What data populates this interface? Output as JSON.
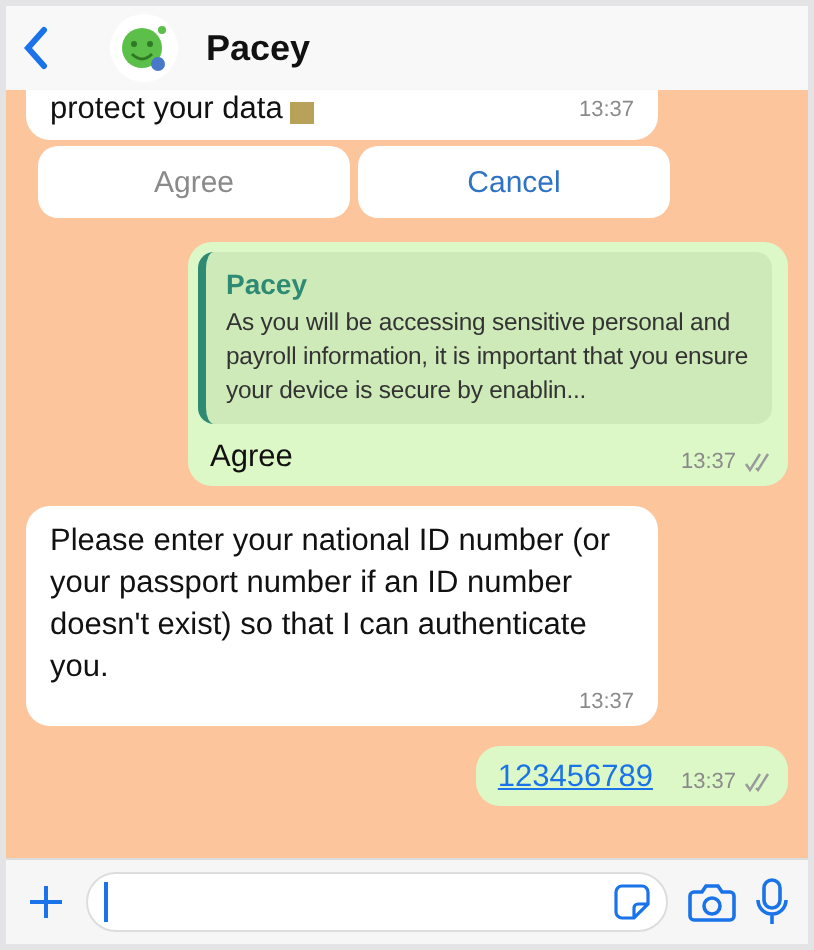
{
  "header": {
    "title": "Pacey"
  },
  "messages": [
    {
      "kind": "incoming",
      "cut_top": true,
      "text": "protect your data",
      "time": "13:37"
    },
    {
      "kind": "quick_replies",
      "buttons": [
        {
          "label": "Agree",
          "disabled": true
        },
        {
          "label": "Cancel",
          "disabled": false
        }
      ]
    },
    {
      "kind": "outgoing",
      "quote": {
        "author": "Pacey",
        "text": "As you will be accessing sensitive personal and payroll information, it is important that you ensure your device is secure by enablin..."
      },
      "text": "Agree",
      "link": false,
      "time": "13:37",
      "read": false
    },
    {
      "kind": "incoming",
      "cut_top": false,
      "text": "Please enter your national ID number (or your passport number if an ID number doesn't exist) so that I can authenticate you.",
      "time": "13:37"
    },
    {
      "kind": "outgoing",
      "text": "123456789",
      "link": true,
      "time": "13:37",
      "read": false
    }
  ]
}
